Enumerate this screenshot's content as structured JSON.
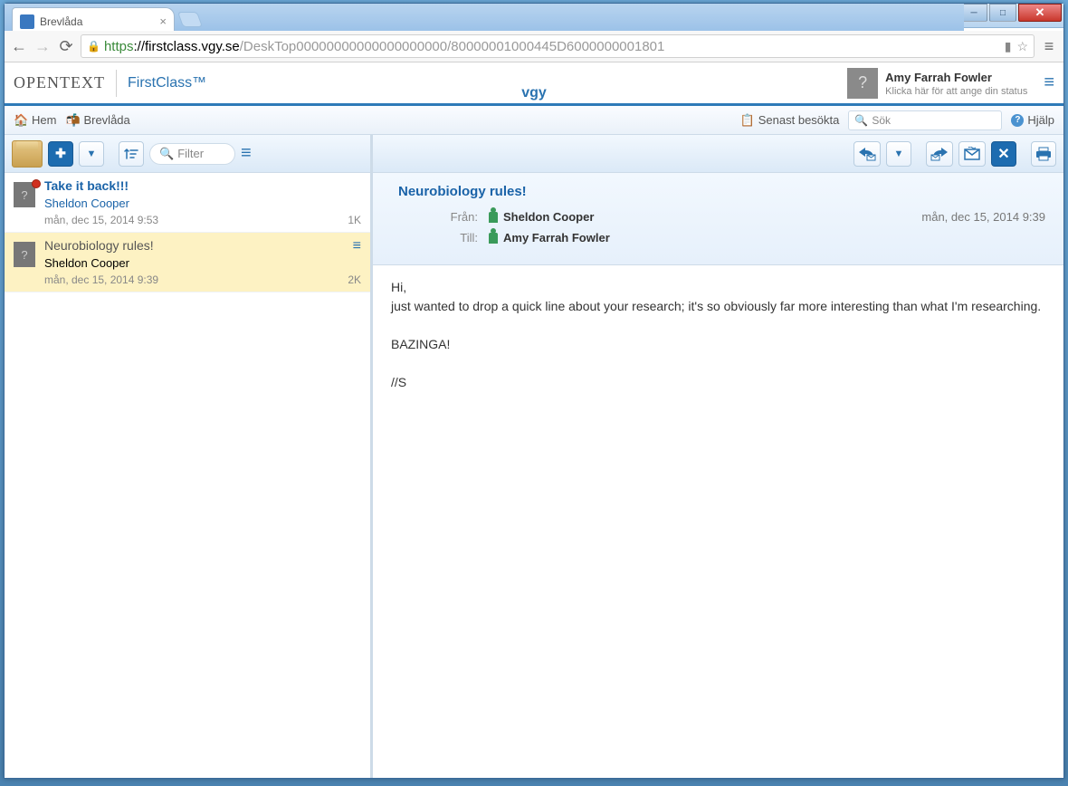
{
  "browser": {
    "tab_title": "Brevlåda",
    "url_https": "https",
    "url_host": "://firstclass.vgy.se",
    "url_path": "/DeskTop00000000000000000000/80000001000445D6000000001801"
  },
  "header": {
    "brand_ot": "OPENTEXT",
    "brand_fc": "FirstClass™",
    "subdomain": "vgy",
    "user_name": "Amy Farrah Fowler",
    "user_status": "Klicka här för att ange din status"
  },
  "breadcrumb": {
    "home": "Hem",
    "mailbox": "Brevlåda",
    "recent": "Senast besökta",
    "search_ph": "Sök",
    "help": "Hjälp"
  },
  "list_toolbar": {
    "filter_ph": "Filter"
  },
  "messages": [
    {
      "subject": "Take it back!!!",
      "sender": "Sheldon Cooper",
      "date": "mån, dec 15, 2014 9:53",
      "size": "1K",
      "unread": true,
      "selected": false,
      "flag": true
    },
    {
      "subject": "Neurobiology rules!",
      "sender": "Sheldon Cooper",
      "date": "mån, dec 15, 2014 9:39",
      "size": "2K",
      "unread": false,
      "selected": true,
      "flag": false
    }
  ],
  "message_view": {
    "subject": "Neurobiology rules!",
    "from_label": "Från:",
    "to_label": "Till:",
    "from": "Sheldon Cooper",
    "to": "Amy Farrah Fowler",
    "date": "mån, dec 15, 2014 9:39",
    "body": "Hi,\njust wanted to drop a quick line about your research; it's so obviously far more interesting than what I'm researching.\n\nBAZINGA!\n\n//S"
  }
}
